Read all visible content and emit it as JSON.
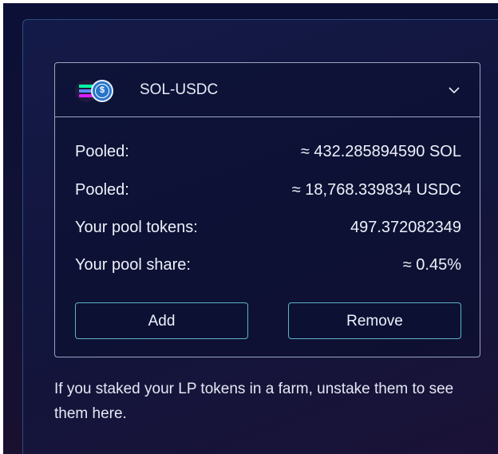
{
  "pool": {
    "name": "SOL-USDC",
    "icons": [
      "solana-icon",
      "usdc-icon"
    ],
    "stats": [
      {
        "label": "Pooled:",
        "value": "≈ 432.285894590 SOL"
      },
      {
        "label": "Pooled:",
        "value": "≈ 18,768.339834 USDC"
      },
      {
        "label": "Your pool tokens:",
        "value": "497.372082349"
      },
      {
        "label": "Your pool share:",
        "value": "≈ 0.45%"
      }
    ],
    "add_label": "Add",
    "remove_label": "Remove"
  },
  "note": "If you staked your LP tokens in a farm, unstake them to see them here.",
  "colors": {
    "background": "#0c0f36",
    "card_border": "#9aa6c0",
    "button_border": "#5fb3c8",
    "usdc_blue": "#2775ca",
    "solana_top": "#00ffa3",
    "solana_mid": "#5b8cff",
    "solana_bottom": "#dc1fff"
  }
}
